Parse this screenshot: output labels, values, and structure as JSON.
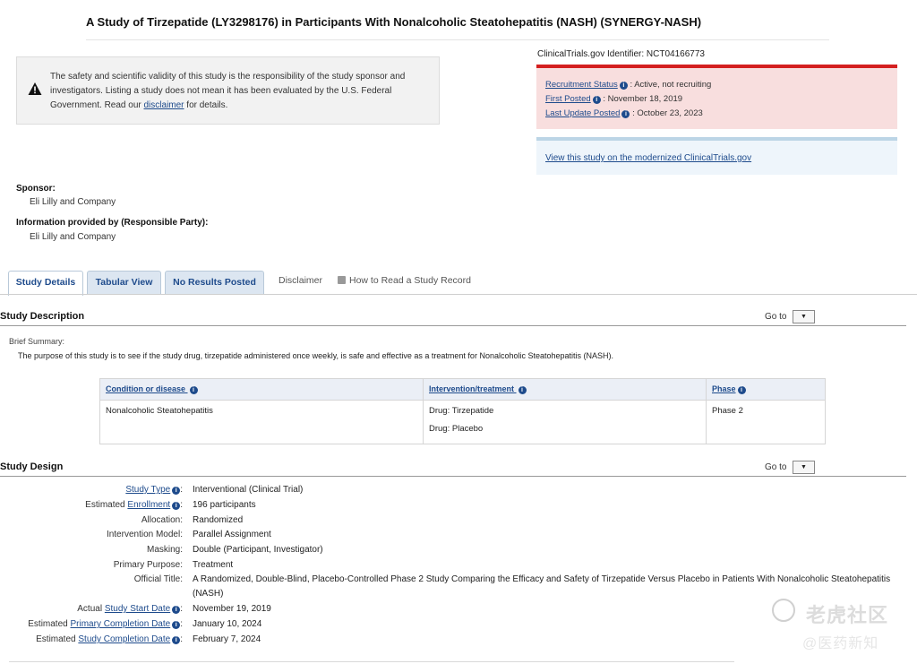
{
  "page": {
    "title": "A Study of Tirzepatide (LY3298176) in Participants With Nonalcoholic Steatohepatitis (NASH) (SYNERGY-NASH)"
  },
  "notice": {
    "text_before": "The safety and scientific validity of this study is the responsibility of the study sponsor and investigators. Listing a study does not mean it has been evaluated by the U.S. Federal Government. Read our ",
    "link": "disclaimer",
    "text_after": " for details."
  },
  "identifier": {
    "label": "ClinicalTrials.gov Identifier:",
    "value": "NCT04166773"
  },
  "status": {
    "recruitment_label": "Recruitment Status",
    "recruitment_value": ": Active, not recruiting",
    "first_posted_label": "First Posted",
    "first_posted_value": ": November 18, 2019",
    "last_update_label": "Last Update Posted",
    "last_update_value": ": October 23, 2023"
  },
  "modern_link": "View this study on the modernized ClinicalTrials.gov",
  "sponsor": {
    "label": "Sponsor:",
    "value": "Eli Lilly and Company",
    "info_label": "Information provided by (Responsible Party):",
    "info_value": "Eli Lilly and Company"
  },
  "tabs": [
    {
      "label": "Study Details"
    },
    {
      "label": "Tabular View"
    },
    {
      "label": "No Results Posted"
    },
    {
      "label": "Disclaimer"
    },
    {
      "label": "How to Read a Study Record"
    }
  ],
  "study_description": {
    "heading": "Study Description",
    "goto": "Go to",
    "brief_label": "Brief Summary:",
    "brief_text": "The purpose of this study is to see if the study drug, tirzepatide administered once weekly, is safe and effective as a treatment for Nonalcoholic Steatohepatitis (NASH).",
    "table": {
      "headers": [
        "Condition or disease",
        "Intervention/treatment",
        "Phase"
      ],
      "condition": "Nonalcoholic Steatohepatitis",
      "interventions": [
        "Drug: Tirzepatide",
        "Drug: Placebo"
      ],
      "phase": "Phase 2"
    }
  },
  "study_design": {
    "heading": "Study Design",
    "goto": "Go to",
    "rows": [
      {
        "pre": "",
        "link": "Study Type",
        "info": true,
        "value": "Interventional  (Clinical Trial)"
      },
      {
        "pre": "Estimated ",
        "link": "Enrollment",
        "info": true,
        "value": "196 participants"
      },
      {
        "pre": "Allocation:",
        "link": "",
        "info": false,
        "value": "Randomized"
      },
      {
        "pre": "Intervention Model:",
        "link": "",
        "info": false,
        "value": "Parallel Assignment"
      },
      {
        "pre": "Masking:",
        "link": "",
        "info": false,
        "value": "Double (Participant, Investigator)"
      },
      {
        "pre": "Primary Purpose:",
        "link": "",
        "info": false,
        "value": "Treatment"
      },
      {
        "pre": "Official Title:",
        "link": "",
        "info": false,
        "value": "A Randomized, Double-Blind, Placebo-Controlled Phase 2 Study Comparing the Efficacy and Safety of Tirzepatide Versus Placebo in Patients With Nonalcoholic Steatohepatitis",
        "value2": "(NASH)"
      },
      {
        "pre": "Actual ",
        "link": "Study Start Date",
        "info": true,
        "value": "November 19, 2019"
      },
      {
        "pre": "Estimated ",
        "link": "Primary Completion Date",
        "info": true,
        "value": "January 10, 2024"
      },
      {
        "pre": "Estimated ",
        "link": "Study Completion Date",
        "info": true,
        "value": "February 7, 2024"
      }
    ]
  },
  "watermark": {
    "main": "老虎社区",
    "sub": "@医药新知"
  }
}
